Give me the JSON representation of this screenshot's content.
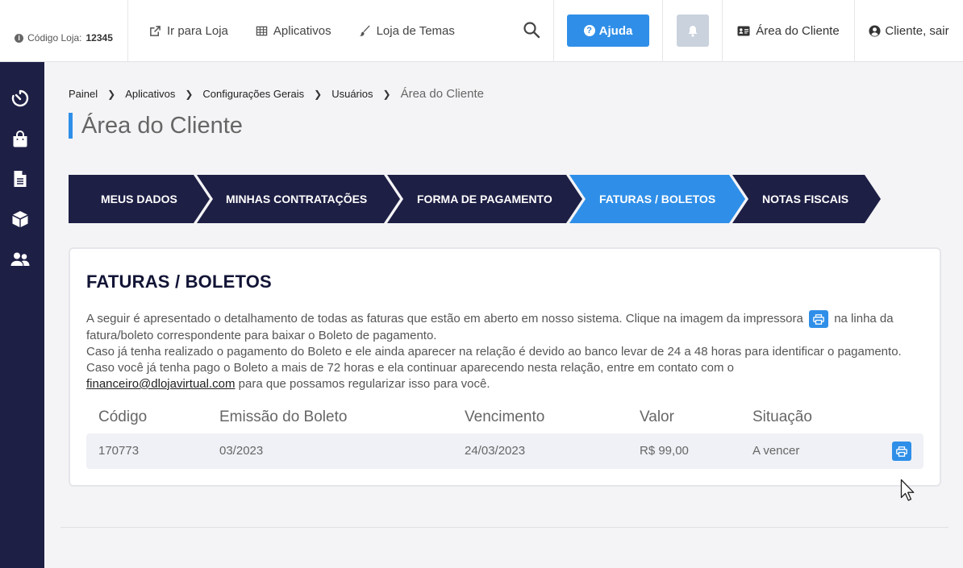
{
  "topbar": {
    "store_label": "Código Loja:",
    "store_code": "12345",
    "links": [
      {
        "label": "Ir para Loja",
        "icon": "external-link-icon"
      },
      {
        "label": "Aplicativos",
        "icon": "grid-icon"
      },
      {
        "label": "Loja de Temas",
        "icon": "brush-icon"
      }
    ],
    "help_label": "Ajuda",
    "area_label": "Área do Cliente",
    "user_label": "Cliente, sair"
  },
  "sidebar": {
    "icons": [
      "dashboard-timer-icon",
      "shopping-bag-icon",
      "document-icon",
      "box-icon",
      "users-icon"
    ]
  },
  "breadcrumb": [
    "Painel",
    "Aplicativos",
    "Configurações Gerais",
    "Usuários"
  ],
  "breadcrumb_current": "Área do Cliente",
  "page_title": "Área do Cliente",
  "tabs": [
    {
      "label": "MEUS DADOS",
      "active": false
    },
    {
      "label": "MINHAS CONTRATAÇÕES",
      "active": false
    },
    {
      "label": "FORMA DE PAGAMENTO",
      "active": false
    },
    {
      "label": "FATURAS / BOLETOS",
      "active": true
    },
    {
      "label": "NOTAS FISCAIS",
      "active": false
    }
  ],
  "colors": {
    "sidebar": "#1e1f45",
    "tab_dark": "#1e1f45",
    "tab_active": "#2f8fe8",
    "accent": "#2f8fe8"
  },
  "card": {
    "title": "FATURAS / BOLETOS",
    "text_part1": "A seguir é apresentado o detalhamento de todas as faturas que estão em aberto em nosso sistema. Clique na imagem da impressora",
    "text_part2": "na linha da fatura/boleto correspondente para baixar o Boleto de pagamento.",
    "text_part3": "Caso já tenha realizado o pagamento do Boleto e ele ainda aparecer na relação é devido ao banco levar de 24 a 48 horas para identificar o pagamento. Caso você já tenha pago o Boleto a mais de 72 horas e ela continuar aparecendo nesta relação, entre em contato com o",
    "email": "financeiro@dlojavirtual.com",
    "text_part4": "para que possamos regularizar isso para você."
  },
  "table": {
    "headers": [
      "Código",
      "Emissão do Boleto",
      "Vencimento",
      "Valor",
      "Situação"
    ],
    "rows": [
      {
        "codigo": "170773",
        "emissao": "03/2023",
        "vencimento": "24/03/2023",
        "valor": "R$ 99,00",
        "situacao": "A vencer"
      }
    ]
  }
}
